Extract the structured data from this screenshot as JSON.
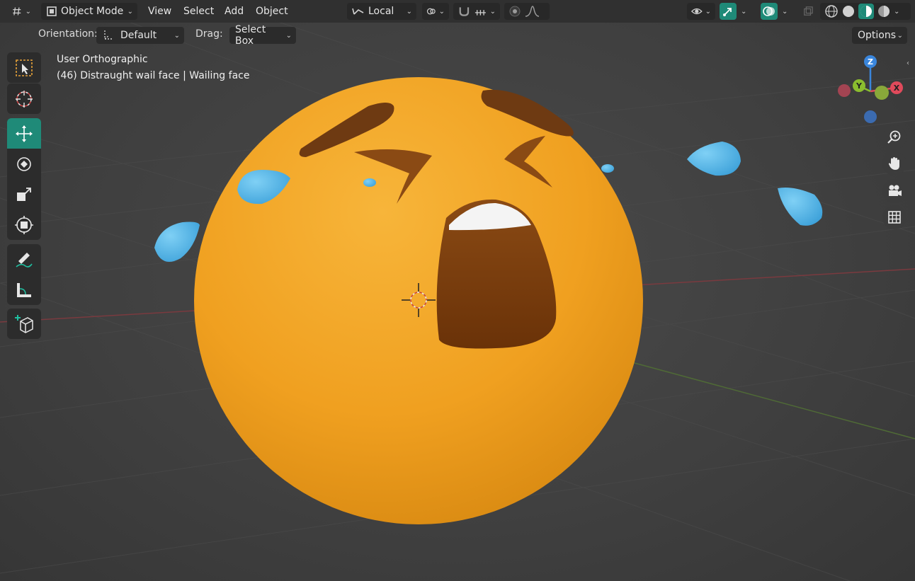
{
  "header": {
    "editor_type_icon": "globe-grid-icon",
    "mode_label": "Object Mode",
    "menu": {
      "view": "View",
      "select": "Select",
      "add": "Add",
      "object": "Object"
    },
    "transform_orientation": "Local",
    "snapping_icon": "magnet-icon",
    "proportional_icon": "proportional-falloff-icon"
  },
  "tool_settings": {
    "orientation_label": "Orientation:",
    "orientation_value": "Default",
    "drag_label": "Drag:",
    "drag_value": "Select Box",
    "options_label": "Options"
  },
  "viewport": {
    "view_name": "User Orthographic",
    "object_info": "(46) Distraught wail face | Wailing face"
  },
  "toolbar": {
    "tools": [
      "select-box",
      "cursor",
      "move",
      "rotate",
      "scale",
      "transform",
      "annotate",
      "measure",
      "add-cube"
    ],
    "active_tool": "move"
  },
  "gizmo": {
    "z": "Z",
    "y": "Y",
    "x": "X"
  },
  "colors": {
    "accent": "#1f8a78",
    "face": "#f2a623",
    "tear": "#4cb3e6",
    "brow": "#6e3a12",
    "axis_x": "#e04a5b",
    "axis_y": "#8bbd2e",
    "axis_z": "#3a86dc"
  }
}
